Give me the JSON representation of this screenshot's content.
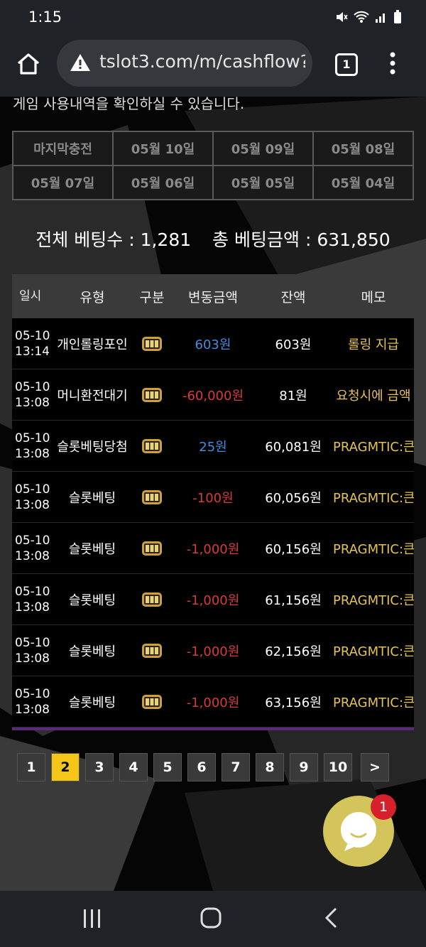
{
  "status": {
    "time": "1:15"
  },
  "browser": {
    "url": "tslot3.com/m/cashflow?",
    "tab_count": "1"
  },
  "intro_text": "게임 사용내역을 확인하실 수 있습니다.",
  "date_tabs": [
    {
      "label": "마지막충전"
    },
    {
      "label": "05월 10일"
    },
    {
      "label": "05월 09일"
    },
    {
      "label": "05월 08일"
    },
    {
      "label": "05월 07일"
    },
    {
      "label": "05월 06일"
    },
    {
      "label": "05월 05일"
    },
    {
      "label": "05월 04일"
    }
  ],
  "summary": {
    "bet_count_label": "전체 베팅수 : ",
    "bet_count": "1,281",
    "bet_amount_label": "총 베팅금액 : ",
    "bet_amount": "631,850"
  },
  "table": {
    "headers": [
      "일시",
      "유형",
      "구분",
      "변동금액",
      "잔액",
      "메모"
    ],
    "rows": [
      {
        "date": "05-10",
        "time": "13:14",
        "type": "개인롤링포인",
        "amount": "603원",
        "amount_color": "#3f8ee0",
        "balance": "603원",
        "memo": "롤링 지급"
      },
      {
        "date": "05-10",
        "time": "13:08",
        "type": "머니환전대기",
        "amount": "-60,000원",
        "amount_color": "#d93a3a",
        "balance": "81원",
        "memo": "요청시에 금액"
      },
      {
        "date": "05-10",
        "time": "13:08",
        "type": "슬롯베팅당첨",
        "amount": "25원",
        "amount_color": "#3f8ee0",
        "balance": "60,081원",
        "memo": "PRAGMTIC:큰"
      },
      {
        "date": "05-10",
        "time": "13:08",
        "type": "슬롯베팅",
        "amount": "-100원",
        "amount_color": "#d93a3a",
        "balance": "60,056원",
        "memo": "PRAGMTIC:큰"
      },
      {
        "date": "05-10",
        "time": "13:08",
        "type": "슬롯베팅",
        "amount": "-1,000원",
        "amount_color": "#d93a3a",
        "balance": "60,156원",
        "memo": "PRAGMTIC:큰"
      },
      {
        "date": "05-10",
        "time": "13:08",
        "type": "슬롯베팅",
        "amount": "-1,000원",
        "amount_color": "#d93a3a",
        "balance": "61,156원",
        "memo": "PRAGMTIC:큰"
      },
      {
        "date": "05-10",
        "time": "13:08",
        "type": "슬롯베팅",
        "amount": "-1,000원",
        "amount_color": "#d93a3a",
        "balance": "62,156원",
        "memo": "PRAGMTIC:큰"
      },
      {
        "date": "05-10",
        "time": "13:08",
        "type": "슬롯베팅",
        "amount": "-1,000원",
        "amount_color": "#d93a3a",
        "balance": "63,156원",
        "memo": "PRAGMTIC:큰"
      }
    ]
  },
  "pagination": {
    "pages": [
      "1",
      "2",
      "3",
      "4",
      "5",
      "6",
      "7",
      "8",
      "9",
      "10"
    ],
    "current": "2",
    "next": ">"
  },
  "chat": {
    "badge": "1"
  },
  "colors": {
    "accent": "#f5c518",
    "memo": "#e6c250",
    "positive": "#3f8ee0",
    "negative": "#d93a3a"
  }
}
